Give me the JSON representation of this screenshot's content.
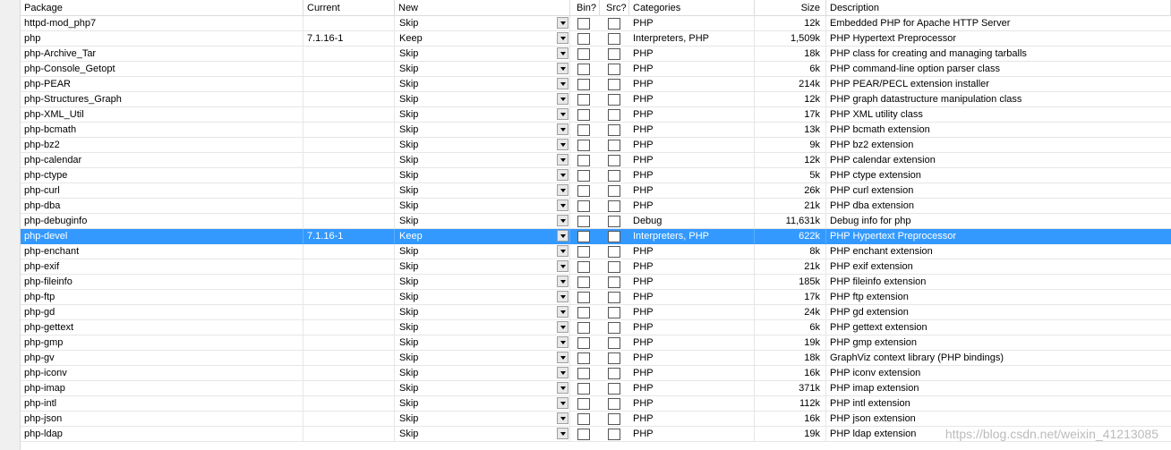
{
  "columns": {
    "package": "Package",
    "current": "Current",
    "new": "New",
    "bin": "Bin?",
    "src": "Src?",
    "categories": "Categories",
    "size": "Size",
    "description": "Description"
  },
  "rows": [
    {
      "package": "httpd-mod_php7",
      "current": "",
      "new": "Skip",
      "categories": "PHP",
      "size": "12k",
      "description": "Embedded PHP for Apache HTTP Server"
    },
    {
      "package": "php",
      "current": "7.1.16-1",
      "new": "Keep",
      "categories": "Interpreters, PHP",
      "size": "1,509k",
      "description": "PHP Hypertext Preprocessor"
    },
    {
      "package": "php-Archive_Tar",
      "current": "",
      "new": "Skip",
      "categories": "PHP",
      "size": "18k",
      "description": "PHP class for creating and managing tarballs"
    },
    {
      "package": "php-Console_Getopt",
      "current": "",
      "new": "Skip",
      "categories": "PHP",
      "size": "6k",
      "description": "PHP command-line option parser class"
    },
    {
      "package": "php-PEAR",
      "current": "",
      "new": "Skip",
      "categories": "PHP",
      "size": "214k",
      "description": "PHP PEAR/PECL extension installer"
    },
    {
      "package": "php-Structures_Graph",
      "current": "",
      "new": "Skip",
      "categories": "PHP",
      "size": "12k",
      "description": "PHP graph datastructure manipulation class"
    },
    {
      "package": "php-XML_Util",
      "current": "",
      "new": "Skip",
      "categories": "PHP",
      "size": "17k",
      "description": "PHP XML utility class"
    },
    {
      "package": "php-bcmath",
      "current": "",
      "new": "Skip",
      "categories": "PHP",
      "size": "13k",
      "description": "PHP bcmath extension"
    },
    {
      "package": "php-bz2",
      "current": "",
      "new": "Skip",
      "categories": "PHP",
      "size": "9k",
      "description": "PHP bz2 extension"
    },
    {
      "package": "php-calendar",
      "current": "",
      "new": "Skip",
      "categories": "PHP",
      "size": "12k",
      "description": "PHP calendar extension"
    },
    {
      "package": "php-ctype",
      "current": "",
      "new": "Skip",
      "categories": "PHP",
      "size": "5k",
      "description": "PHP ctype extension"
    },
    {
      "package": "php-curl",
      "current": "",
      "new": "Skip",
      "categories": "PHP",
      "size": "26k",
      "description": "PHP curl extension"
    },
    {
      "package": "php-dba",
      "current": "",
      "new": "Skip",
      "categories": "PHP",
      "size": "21k",
      "description": "PHP dba extension"
    },
    {
      "package": "php-debuginfo",
      "current": "",
      "new": "Skip",
      "categories": "Debug",
      "size": "11,631k",
      "description": "Debug info for php"
    },
    {
      "package": "php-devel",
      "current": "7.1.16-1",
      "new": "Keep",
      "categories": "Interpreters, PHP",
      "size": "622k",
      "description": "PHP Hypertext Preprocessor",
      "selected": true
    },
    {
      "package": "php-enchant",
      "current": "",
      "new": "Skip",
      "categories": "PHP",
      "size": "8k",
      "description": "PHP enchant extension"
    },
    {
      "package": "php-exif",
      "current": "",
      "new": "Skip",
      "categories": "PHP",
      "size": "21k",
      "description": "PHP exif extension"
    },
    {
      "package": "php-fileinfo",
      "current": "",
      "new": "Skip",
      "categories": "PHP",
      "size": "185k",
      "description": "PHP fileinfo extension"
    },
    {
      "package": "php-ftp",
      "current": "",
      "new": "Skip",
      "categories": "PHP",
      "size": "17k",
      "description": "PHP ftp extension"
    },
    {
      "package": "php-gd",
      "current": "",
      "new": "Skip",
      "categories": "PHP",
      "size": "24k",
      "description": "PHP gd extension"
    },
    {
      "package": "php-gettext",
      "current": "",
      "new": "Skip",
      "categories": "PHP",
      "size": "6k",
      "description": "PHP gettext extension"
    },
    {
      "package": "php-gmp",
      "current": "",
      "new": "Skip",
      "categories": "PHP",
      "size": "19k",
      "description": "PHP gmp extension"
    },
    {
      "package": "php-gv",
      "current": "",
      "new": "Skip",
      "categories": "PHP",
      "size": "18k",
      "description": "GraphViz context library (PHP bindings)"
    },
    {
      "package": "php-iconv",
      "current": "",
      "new": "Skip",
      "categories": "PHP",
      "size": "16k",
      "description": "PHP iconv extension"
    },
    {
      "package": "php-imap",
      "current": "",
      "new": "Skip",
      "categories": "PHP",
      "size": "371k",
      "description": "PHP imap extension"
    },
    {
      "package": "php-intl",
      "current": "",
      "new": "Skip",
      "categories": "PHP",
      "size": "112k",
      "description": "PHP intl extension"
    },
    {
      "package": "php-json",
      "current": "",
      "new": "Skip",
      "categories": "PHP",
      "size": "16k",
      "description": "PHP json extension"
    },
    {
      "package": "php-ldap",
      "current": "",
      "new": "Skip",
      "categories": "PHP",
      "size": "19k",
      "description": "PHP ldap extension"
    }
  ],
  "watermark": "https://blog.csdn.net/weixin_41213085",
  "colors": {
    "selection": "#3399ff"
  }
}
